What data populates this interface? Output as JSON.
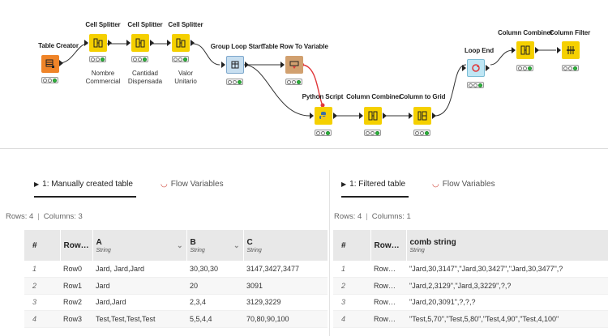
{
  "workflow": {
    "nodes": {
      "table_creator": {
        "title": "Table Creator"
      },
      "cell_splitter_1": {
        "title": "Cell Splitter",
        "caption": [
          "Nombre",
          "Commercial"
        ]
      },
      "cell_splitter_2": {
        "title": "Cell Splitter",
        "caption": [
          "Cantidad",
          "Dispensada"
        ]
      },
      "cell_splitter_3": {
        "title": "Cell Splitter",
        "caption": [
          "Valor",
          "Unitario"
        ]
      },
      "group_loop_start": {
        "title": "Group Loop Start"
      },
      "table_row_to_variable": {
        "title": "Table Row To Variable"
      },
      "python_script": {
        "title": "Python Script"
      },
      "column_combiner_1": {
        "title": "Column Combiner"
      },
      "column_to_grid": {
        "title": "Column to Grid"
      },
      "loop_end": {
        "title": "Loop End"
      },
      "column_combiner_2": {
        "title": "Column Combiner"
      },
      "column_filter": {
        "title": "Column Filter"
      }
    },
    "colors": {
      "node_yellow": "#f5d000",
      "node_orange": "#ef8428",
      "node_brown": "#d1a06f",
      "status_green": "#2db53c",
      "variable_wire": "#e0373a"
    }
  },
  "left_panel": {
    "tab_active": "1: Manually created table",
    "tab_inactive": "Flow Variables",
    "rows_label": "Rows: 4",
    "columns_label": "Columns: 3",
    "table": {
      "index_header": "#",
      "rowid_header": "Row…",
      "columns": [
        {
          "name": "A",
          "type": "String"
        },
        {
          "name": "B",
          "type": "String"
        },
        {
          "name": "C",
          "type": "String"
        }
      ],
      "rows": [
        {
          "idx": "1",
          "id": "Row0",
          "cells": [
            "Jard, Jard,Jard",
            "30,30,30",
            "3147,3427,3477"
          ]
        },
        {
          "idx": "2",
          "id": "Row1",
          "cells": [
            "Jard",
            "20",
            "3091"
          ]
        },
        {
          "idx": "3",
          "id": "Row2",
          "cells": [
            "Jard,Jard",
            "2,3,4",
            "3129,3229"
          ]
        },
        {
          "idx": "4",
          "id": "Row3",
          "cells": [
            "Test,Test,Test,Test",
            "5,5,4,4",
            "70,80,90,100"
          ]
        }
      ]
    }
  },
  "right_panel": {
    "tab_active": "1: Filtered table",
    "tab_inactive": "Flow Variables",
    "rows_label": "Rows: 4",
    "columns_label": "Columns: 1",
    "table": {
      "index_header": "#",
      "rowid_header": "Row…",
      "columns": [
        {
          "name": "comb string",
          "type": "String"
        }
      ],
      "rows": [
        {
          "idx": "1",
          "id": "Row…",
          "cells": [
            "\"Jard,30,3147\",\"Jard,30,3427\",\"Jard,30,3477\",?"
          ]
        },
        {
          "idx": "2",
          "id": "Row…",
          "cells": [
            "\"Jard,2,3129\",\"Jard,3,3229\",?,?"
          ]
        },
        {
          "idx": "3",
          "id": "Row…",
          "cells": [
            "\"Jard,20,3091\",?,?,?"
          ]
        },
        {
          "idx": "4",
          "id": "Row…",
          "cells": [
            "\"Test,5,70\",\"Test,5,80\",\"Test,4,90\",\"Test,4,100\""
          ]
        }
      ]
    }
  }
}
